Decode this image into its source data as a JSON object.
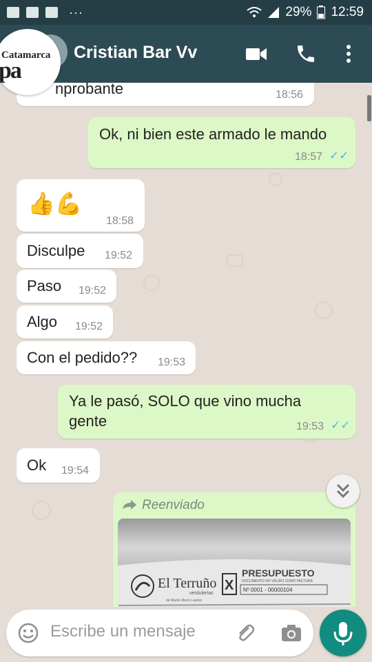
{
  "status_bar": {
    "battery": "29%",
    "time": "12:59",
    "more": "···"
  },
  "header": {
    "contact_name": "Cristian Bar Vv",
    "avatar_text_top": "Catamarca",
    "avatar_text_bottom": "pa"
  },
  "messages": [
    {
      "dir": "in",
      "text": "Comprobante",
      "visible_text": "nprobante",
      "time": "18:56"
    },
    {
      "dir": "out",
      "text": "Ok, ni bien este armado le mando",
      "time": "18:57",
      "ticks": "✓✓"
    },
    {
      "dir": "in",
      "text": "👍💪",
      "time": "18:58"
    },
    {
      "dir": "in",
      "text": "Disculpe",
      "time": "19:52"
    },
    {
      "dir": "in",
      "text": "Paso",
      "time": "19:52"
    },
    {
      "dir": "in",
      "text": "Algo",
      "time": "19:52"
    },
    {
      "dir": "in",
      "text": "Con el pedido??",
      "time": "19:53"
    },
    {
      "dir": "out",
      "text_line1": "Ya le pasó, SOLO que vino mucha",
      "text_line2": "gente",
      "time": "19:53",
      "ticks": "✓✓"
    },
    {
      "dir": "in",
      "text": "Ok",
      "time": "19:54"
    },
    {
      "dir": "out",
      "forwarded_label": "Reenviado",
      "attachment": "image"
    }
  ],
  "attachment_image": {
    "brand": "El Terruño",
    "brand_sub": "verdulerías",
    "brand_tag": "de Martin Mario Lasdes",
    "doc_type_letter": "X",
    "doc_title": "PRESUPUESTO",
    "doc_note": "DOCUMENTO NO VÁLIDO COMO FACTURA",
    "doc_number": "Nº 0001 - 00000104"
  },
  "composer": {
    "placeholder": "Escribe un mensaje"
  },
  "icons": {
    "video": "video-call-icon",
    "call": "phone-icon",
    "menu": "more-vert-icon",
    "emoji": "emoji-icon",
    "attach": "paperclip-icon",
    "camera": "camera-icon",
    "mic": "microphone-icon",
    "forward": "forward-arrow-icon",
    "scroll": "double-chevron-down-icon"
  },
  "colors": {
    "header": "#2d4b54",
    "status": "#253e46",
    "outgoing": "#dcf8c6",
    "incoming": "#ffffff",
    "read_ticks": "#4fb6ec",
    "mic": "#128c7e"
  }
}
